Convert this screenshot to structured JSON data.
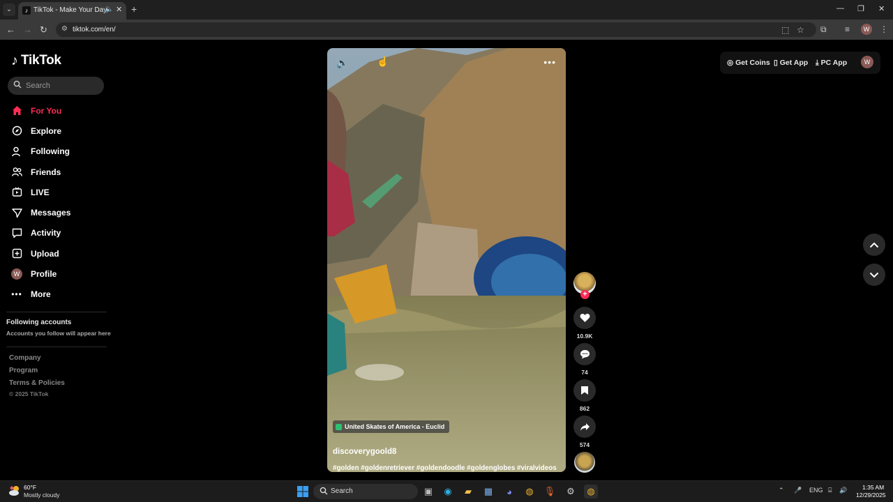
{
  "browser": {
    "tab_title": "TikTok - Make Your Day",
    "url": "tiktok.com/en/",
    "profile_initial": "W"
  },
  "sidebar": {
    "logo_text": "TikTok",
    "search_placeholder": "Search",
    "nav": [
      {
        "label": "For You",
        "icon": "home-icon"
      },
      {
        "label": "Explore",
        "icon": "compass-icon"
      },
      {
        "label": "Following",
        "icon": "person-icon"
      },
      {
        "label": "Friends",
        "icon": "friends-icon"
      },
      {
        "label": "LIVE",
        "icon": "live-icon"
      },
      {
        "label": "Messages",
        "icon": "send-icon"
      },
      {
        "label": "Activity",
        "icon": "message-icon"
      },
      {
        "label": "Upload",
        "icon": "upload-icon"
      },
      {
        "label": "Profile",
        "icon": "avatar",
        "initial": "W"
      },
      {
        "label": "More",
        "icon": "more-icon"
      }
    ],
    "following_heading": "Following accounts",
    "following_sub": "Accounts you follow will appear here",
    "footer": [
      "Company",
      "Program",
      "Terms & Policies"
    ],
    "copyright": "© 2025 TikTok"
  },
  "video": {
    "location": "United Skates of America - Euclid",
    "author": "discoverygoold8",
    "hashtags": "#golden #goldenretriever #goldendoodle #goldenglobes #viralvideos"
  },
  "actions": {
    "likes": "10.9K",
    "comments": "74",
    "saves": "862",
    "shares": "574"
  },
  "topbar": {
    "get_coins": "Get Coins",
    "get_app": "Get App",
    "pc_app": "PC App",
    "avatar_initial": "W"
  },
  "taskbar": {
    "temperature": "60°F",
    "weather": "Mostly cloudy",
    "search_label": "Search",
    "language": "ENG",
    "time": "1:35 AM",
    "date": "12/29/2025"
  },
  "colors": {
    "accent": "#fe2c55",
    "background": "#000000"
  }
}
